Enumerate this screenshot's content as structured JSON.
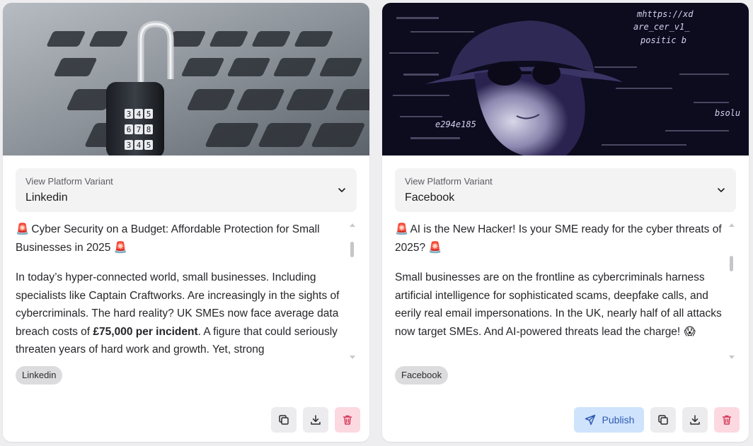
{
  "cards": [
    {
      "image_alt": "padlock-on-laptop-keyboard",
      "variant_label": "View Platform Variant",
      "variant_value": "Linkedin",
      "headline_emoji": "🚨",
      "headline": "Cyber Security on a Budget: Affordable Protection for Small Businesses in 2025",
      "body_before": "In today’s hyper-connected world, small businesses. Including specialists like Captain Craftworks. Are increasingly in the sights of cybercriminals. The hard reality? UK SMEs now face average data breach costs of ",
      "body_bold": "£75,000 per incident",
      "body_after": ". A figure that could seriously threaten years of hard work and growth. Yet, strong",
      "tag": "Linkedin",
      "scroll_fraction": 0.12
    },
    {
      "image_alt": "hacker-with-sunglasses-and-code",
      "variant_label": "View Platform Variant",
      "variant_value": "Facebook",
      "headline_emoji": "🚨",
      "headline": "AI is the New Hacker! Is your SME ready for the cyber threats of 2025?",
      "body_before": "Small businesses are on the frontline as cybercriminals harness artificial intelligence for sophisticated scams, deepfake calls, and eerily real email impersonations. In the UK, nearly half of all attacks now target SMEs. And AI-powered threats lead the charge!",
      "body_emoji": "😱",
      "tag": "Facebook",
      "publish_label": "Publish",
      "scroll_fraction": 0.25
    }
  ],
  "hero_overlay_text": {
    "padlock_digits": [
      "3",
      "4",
      "5",
      "6",
      "7",
      "8",
      "3",
      "4",
      "5"
    ],
    "code_fragments": [
      "mhttps://xd",
      "are_cer_v1_",
      "positic  b",
      "e294e185",
      "bsolu"
    ]
  },
  "colors": {
    "danger_bg": "#fcd9e1",
    "danger_icon": "#d63c5c",
    "publish_bg": "#cfe3fd",
    "publish_fg": "#2f5ab1",
    "hacker_tint": "#2a2350"
  }
}
